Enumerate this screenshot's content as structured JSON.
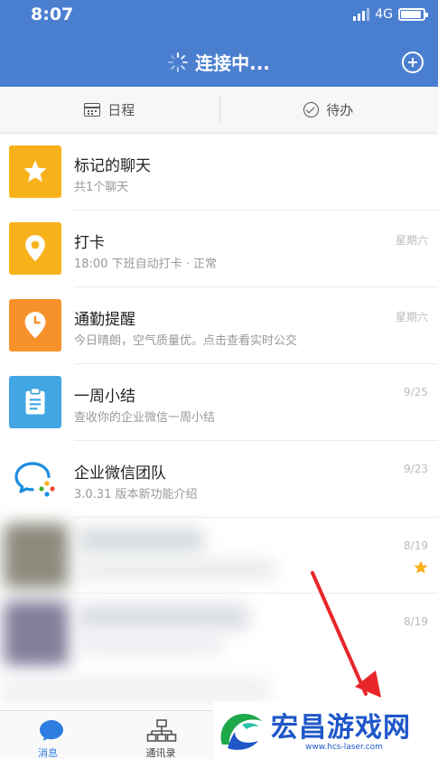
{
  "status_bar": {
    "time": "8:07",
    "network": "4G"
  },
  "nav": {
    "title": "连接中...",
    "add_icon": "plus-circle-icon"
  },
  "tabs": [
    {
      "label": "日程",
      "icon": "calendar-icon"
    },
    {
      "label": "待办",
      "icon": "check-circle-icon"
    }
  ],
  "chats": [
    {
      "name": "标记的聊天",
      "preview": "共1个聊天",
      "time": "",
      "icon": "star-icon",
      "color": "#f7b21b"
    },
    {
      "name": "打卡",
      "preview": "18:00 下班自动打卡 · 正常",
      "time": "星期六",
      "icon": "location-pin-icon",
      "color": "#f7b21b"
    },
    {
      "name": "通勤提醒",
      "preview": "今日晴朗，空气质量优。点击查看实时公交",
      "time": "星期六",
      "icon": "clock-pin-icon",
      "color": "#f7922a"
    },
    {
      "name": "一周小结",
      "preview": "查收你的企业微信一周小结",
      "time": "9/25",
      "icon": "clipboard-icon",
      "color": "#41a6e3"
    },
    {
      "name": "企业微信团队",
      "preview": "3.0.31 版本新功能介绍",
      "time": "9/23",
      "icon": "wework-logo-icon",
      "color": "#ffffff"
    }
  ],
  "blurred_chats": [
    {
      "time": "8/19",
      "starred": true
    },
    {
      "time": "8/19",
      "starred": false
    }
  ],
  "tab_bar": [
    {
      "label": "消息",
      "icon": "chat-bubble-icon",
      "active": true
    },
    {
      "label": "通讯录",
      "icon": "org-chart-icon",
      "active": false
    }
  ],
  "watermark": {
    "title": "宏昌游戏网",
    "url": "www.hcs-laser.com"
  },
  "colors": {
    "brand_blue": "#4a7fd0",
    "active_tab": "#2f7de1",
    "star": "#f7b21b",
    "arrow": "#e8262a"
  }
}
